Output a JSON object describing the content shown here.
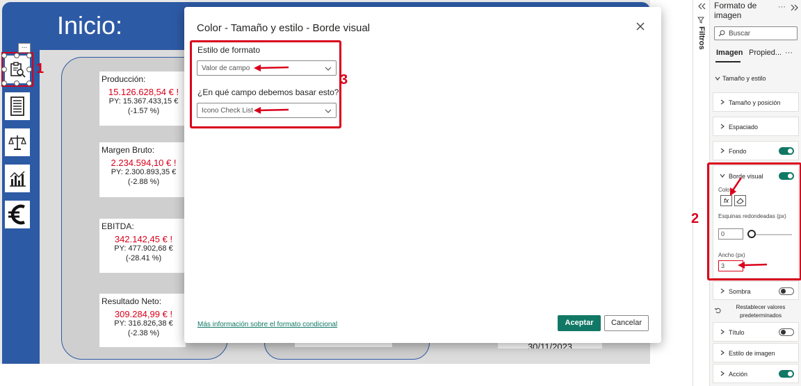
{
  "report": {
    "title": "Inicio:",
    "date_partial": "30/11/2023",
    "kpis": [
      {
        "title": "Producción:",
        "value": "15.126.628,54 € !",
        "py": "PY: 15.367.433,15 €",
        "pct": "(-1.57 %)"
      },
      {
        "title": "Margen Bruto:",
        "value": "2.234.594,10 € !",
        "py": "PY: 2.300.893,35 €",
        "pct": "(-2.88 %)"
      },
      {
        "title": "EBITDA:",
        "value": "342.142,45 € !",
        "py": "PY: 477.902,68 €",
        "pct": "(-28.41 %)"
      },
      {
        "title": "Resultado Neto:",
        "value": "309.284,99 € !",
        "py": "PY: 316.826,38 €",
        "pct": "(-2.38 %)"
      }
    ],
    "more_dots": "...",
    "callouts": [
      "1",
      "2",
      "3"
    ]
  },
  "dialog": {
    "title": "Color - Tamaño y estilo - Borde visual",
    "format_style_label": "Estilo de formato",
    "format_style_value": "Valor de campo",
    "field_label": "¿En qué campo debemos basar esto?",
    "field_value": "Icono Check List",
    "link": "Más información sobre el formato condicional",
    "accept": "Aceptar",
    "cancel": "Cancelar"
  },
  "filters_pane": {
    "label": "Filtros"
  },
  "format_pane": {
    "title": "Formato de imagen",
    "search_placeholder": "Buscar",
    "tab_image": "Imagen",
    "tab_properties": "Propied...",
    "more": "···",
    "section_size_style": "Tamaño y estilo",
    "cards": {
      "size_position": "Tamaño y posición",
      "spacing": "Espaciado",
      "background": "Fondo",
      "visual_border": "Borde visual",
      "shadow": "Sombra",
      "title": "Título",
      "image_style": "Estilo de imagen",
      "action": "Acción"
    },
    "color_label": "Color",
    "rounded_corners_label": "Esquinas redondeadas (px)",
    "rounded_corners_value": "0",
    "width_label": "Ancho (px)",
    "width_value": "3",
    "reset_label": "Restablecer valores predeterminados",
    "fx_label": "fx",
    "colors": {
      "accent": "#117865",
      "highlight": "#d9001b",
      "report_blue": "#2d5aa5"
    }
  }
}
